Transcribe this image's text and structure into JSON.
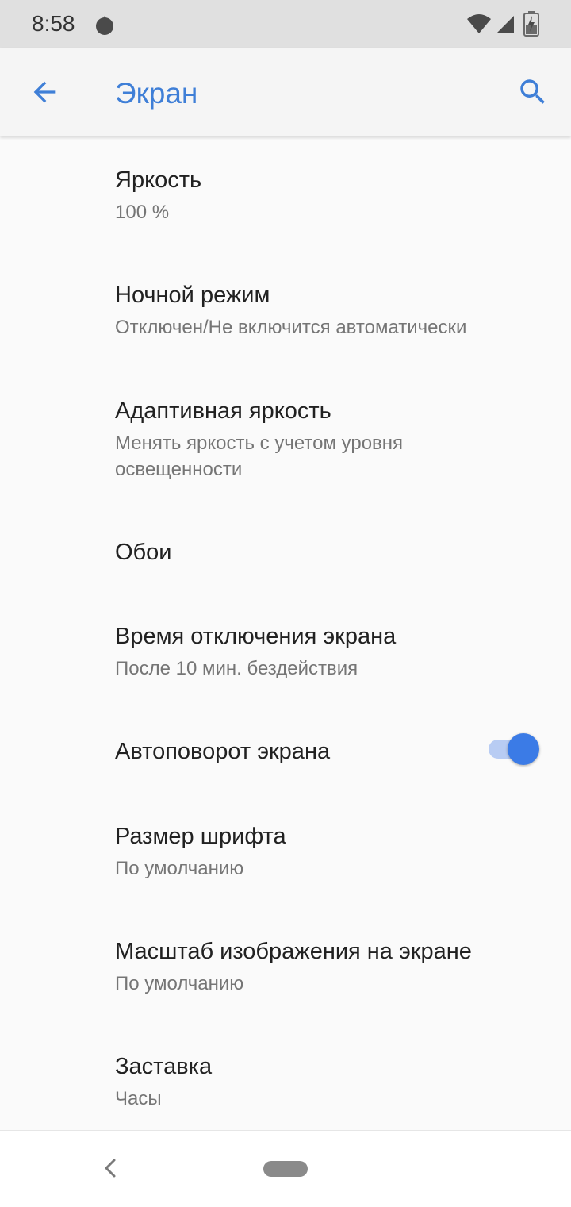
{
  "status_bar": {
    "time": "8:58"
  },
  "app_bar": {
    "title": "Экран"
  },
  "settings": [
    {
      "title": "Яркость",
      "summary": "100 %"
    },
    {
      "title": "Ночной режим",
      "summary": "Отключен/Не включится автоматически"
    },
    {
      "title": "Адаптивная яркость",
      "summary": "Менять яркость с учетом уровня освещенности"
    },
    {
      "title": "Обои"
    },
    {
      "title": "Время отключения экрана",
      "summary": "После 10 мин. бездействия"
    },
    {
      "title": "Автоповорот экрана",
      "toggle_on": true
    },
    {
      "title": "Размер шрифта",
      "summary": "По умолчанию"
    },
    {
      "title": "Масштаб изображения на экране",
      "summary": "По умолчанию"
    },
    {
      "title": "Заставка",
      "summary": "Часы"
    }
  ],
  "colors": {
    "accent": "#3f7fd7",
    "toggle_thumb": "#3b7be6",
    "toggle_track": "#b8ccf3",
    "title_text": "#212121",
    "summary_text": "#757575"
  },
  "icons": {
    "back": "arrow-back-icon",
    "search": "search-icon",
    "wifi": "wifi-icon",
    "signal": "signal-icon",
    "battery": "battery-icon",
    "status_app": "app-notification-icon",
    "nav_back": "nav-back-icon"
  }
}
